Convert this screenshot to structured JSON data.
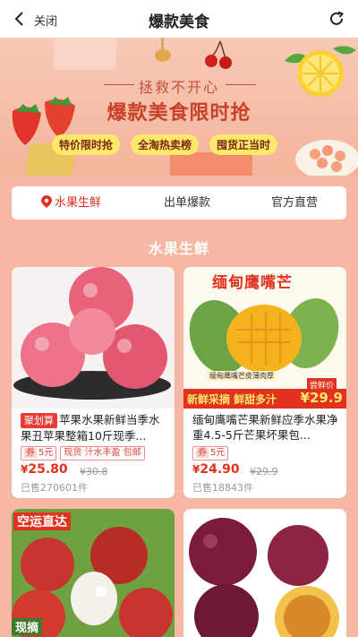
{
  "nav": {
    "back_icon": "chevron-left-icon",
    "close_label": "关闭",
    "title": "爆款美食",
    "refresh_icon": "refresh-icon"
  },
  "banner": {
    "subtitle": "拯救不开心",
    "headline": "爆款美食限时抢",
    "pills": [
      "特价限时抢",
      "全淘热卖榜",
      "囤货正当时"
    ]
  },
  "tabs": [
    {
      "label": "水果生鲜",
      "icon": "location-pin-icon",
      "active": true
    },
    {
      "label": "出单爆款",
      "active": false
    },
    {
      "label": "官方直营",
      "active": false
    }
  ],
  "section_title": "水果生鲜",
  "products": [
    {
      "brand_badge": "聚划算",
      "name": "苹果水果新鲜当季水果丑苹果整箱10斤现季...",
      "coupon_prefix": "券",
      "coupon": "5元",
      "tags": [
        "现货",
        "汁水丰盈",
        "包邮"
      ],
      "price": "25.80",
      "currency": "¥",
      "original_price": "¥30.8",
      "sold": "已售270601件"
    },
    {
      "name": "缅甸鹰嘴芒果新鲜应季水果净重4.5-5斤芒果坏果包...",
      "coupon_prefix": "券",
      "coupon": "5元",
      "image_text": {
        "top": "缅甸鹰嘴芒",
        "caption": "缅甸鹰嘴芒皮薄肉厚",
        "banner_left": "新鲜采摘 鲜甜多汁",
        "badge": "尝鲜价",
        "price": "¥29.9"
      },
      "price": "24.90",
      "currency": "¥",
      "original_price": "¥29.9",
      "sold": "已售18843件"
    },
    {
      "image_text": {
        "top": "空运直达",
        "bottom": "现摘"
      }
    },
    {
      "image_text": {}
    }
  ]
}
